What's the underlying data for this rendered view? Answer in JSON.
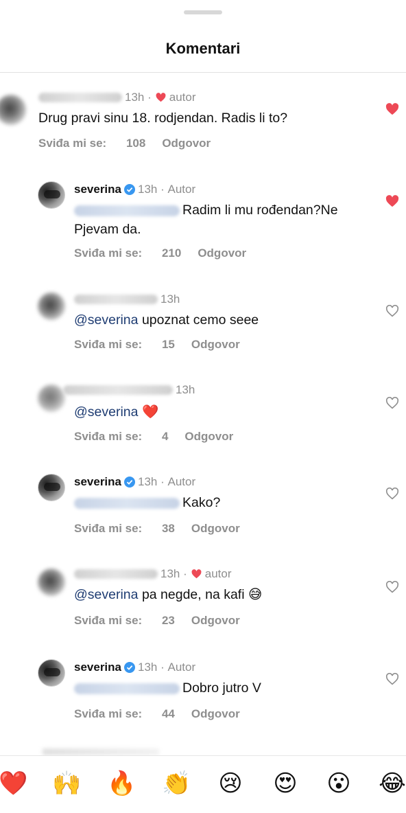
{
  "header": {
    "title": "Komentari"
  },
  "labels": {
    "likes_prefix": "Sviđa mi se:",
    "reply": "Odgovor"
  },
  "comments": [
    {
      "time": "13h",
      "author_tag": "autor",
      "text": "Drug pravi sinu 18. rodjendan. Radis li to?",
      "likes": "108",
      "liked": true
    },
    {
      "username": "severina",
      "time": "13h",
      "author_tag": "Autor",
      "text_line1": "Radim li mu rođendan?Ne",
      "text_line2": "Pjevam da.",
      "likes": "210",
      "liked": true
    },
    {
      "time": "13h",
      "mention": "@severina",
      "text": "upoznat cemo seee",
      "likes": "15",
      "liked": false
    },
    {
      "time": "13h",
      "mention": "@severina",
      "text": "❤️",
      "likes": "4",
      "liked": false
    },
    {
      "username": "severina",
      "time": "13h",
      "author_tag": "Autor",
      "text": "Kako?",
      "likes": "38",
      "liked": false
    },
    {
      "time": "13h",
      "author_tag": "autor",
      "mention": "@severina",
      "text": "pa negde, na kafi 😅",
      "likes": "23",
      "liked": false
    },
    {
      "username": "severina",
      "time": "13h",
      "author_tag": "Autor",
      "text": "Dobro jutro V",
      "likes": "44",
      "liked": false
    }
  ],
  "reactions": [
    "❤️",
    "🙌",
    "🔥",
    "👏",
    "😢",
    "😍",
    "😮",
    "😂"
  ],
  "colors": {
    "heart": "#ed4956",
    "verified": "#3897f0",
    "mention": "#1e3c72",
    "muted": "#8e8e8e"
  }
}
